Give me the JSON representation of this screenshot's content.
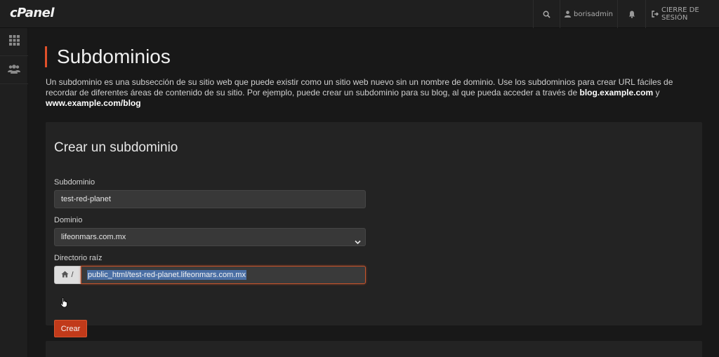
{
  "brand": {
    "logo": "cPanel"
  },
  "topbar": {
    "search_icon": "search-icon",
    "user_label": "borisadmin",
    "notifications_icon": "bell-icon",
    "logout_label": "CIERRE DE SESIÓN"
  },
  "sidebar": {
    "items": [
      {
        "icon": "grid-icon"
      },
      {
        "icon": "users-icon"
      }
    ]
  },
  "page": {
    "title": "Subdominios",
    "intro_text": "Un subdominio es una subsección de su sitio web que puede existir como un sitio web nuevo sin un nombre de dominio. Use los subdominios para crear URL fáciles de recordar de diferentes áreas de contenido de su sitio. Por ejemplo, puede crear un subdominio para su blog, al que pueda acceder a través de ",
    "intro_example1": "blog.example.com",
    "intro_and": " y ",
    "intro_example2": "www.example.com/blog"
  },
  "form": {
    "title": "Crear un subdominio",
    "subdomain_label": "Subdominio",
    "subdomain_value": "test-red-planet",
    "domain_label": "Dominio",
    "domain_value": "lifeonmars.com.mx",
    "docroot_label": "Directorio raíz",
    "docroot_prefix": "/",
    "docroot_value": "public_html/test-red-planet.lifeonmars.com.mx",
    "submit_label": "Crear"
  },
  "colors": {
    "accent": "#e0502a",
    "button": "#c13a1a",
    "background": "#181818",
    "panel": "#232323"
  }
}
